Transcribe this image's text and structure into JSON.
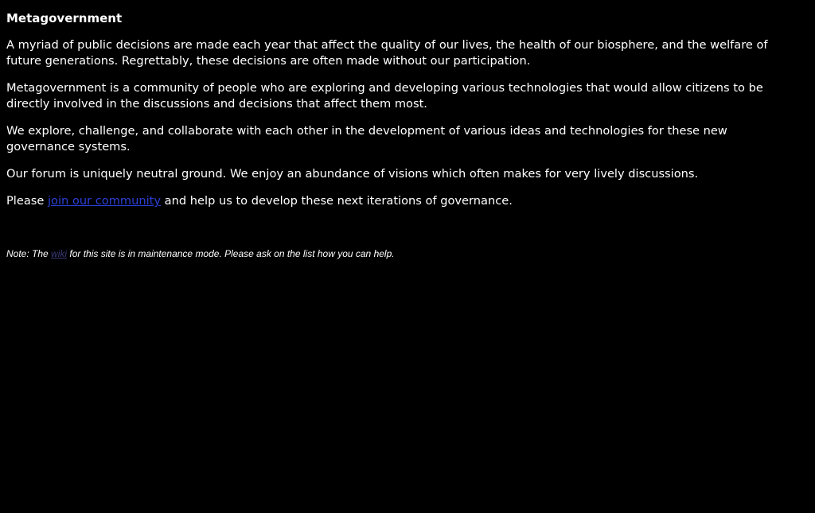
{
  "title": "Metagovernment",
  "paragraphs": [
    "A myriad of public decisions are made each year that affect the quality of our lives, the health of our biosphere, and the welfare of future generations. Regrettably, these decisions are often made without our participation.",
    "Metagovernment is a community of people who are exploring and developing various technologies that would allow citizens to be directly involved in the discussions and decisions that affect them most.",
    "We explore, challenge, and collaborate with each other in the development of various ideas and technologies for these new governance systems.",
    "Our forum is uniquely neutral ground. We enjoy an abundance of visions which often makes for very lively discussions."
  ],
  "cta": {
    "before": "Please ",
    "link": "join our community",
    "after": " and help us to develop these next iterations of governance."
  },
  "note": {
    "before": "Note: The ",
    "link": "wiki",
    "after": " for this site is in maintenance mode. Please ask on the list how you can help."
  },
  "colors": {
    "background": "#000000",
    "text": "#ffffff",
    "link": "#2b3fd6",
    "visited_link": "#3a3a7a"
  }
}
